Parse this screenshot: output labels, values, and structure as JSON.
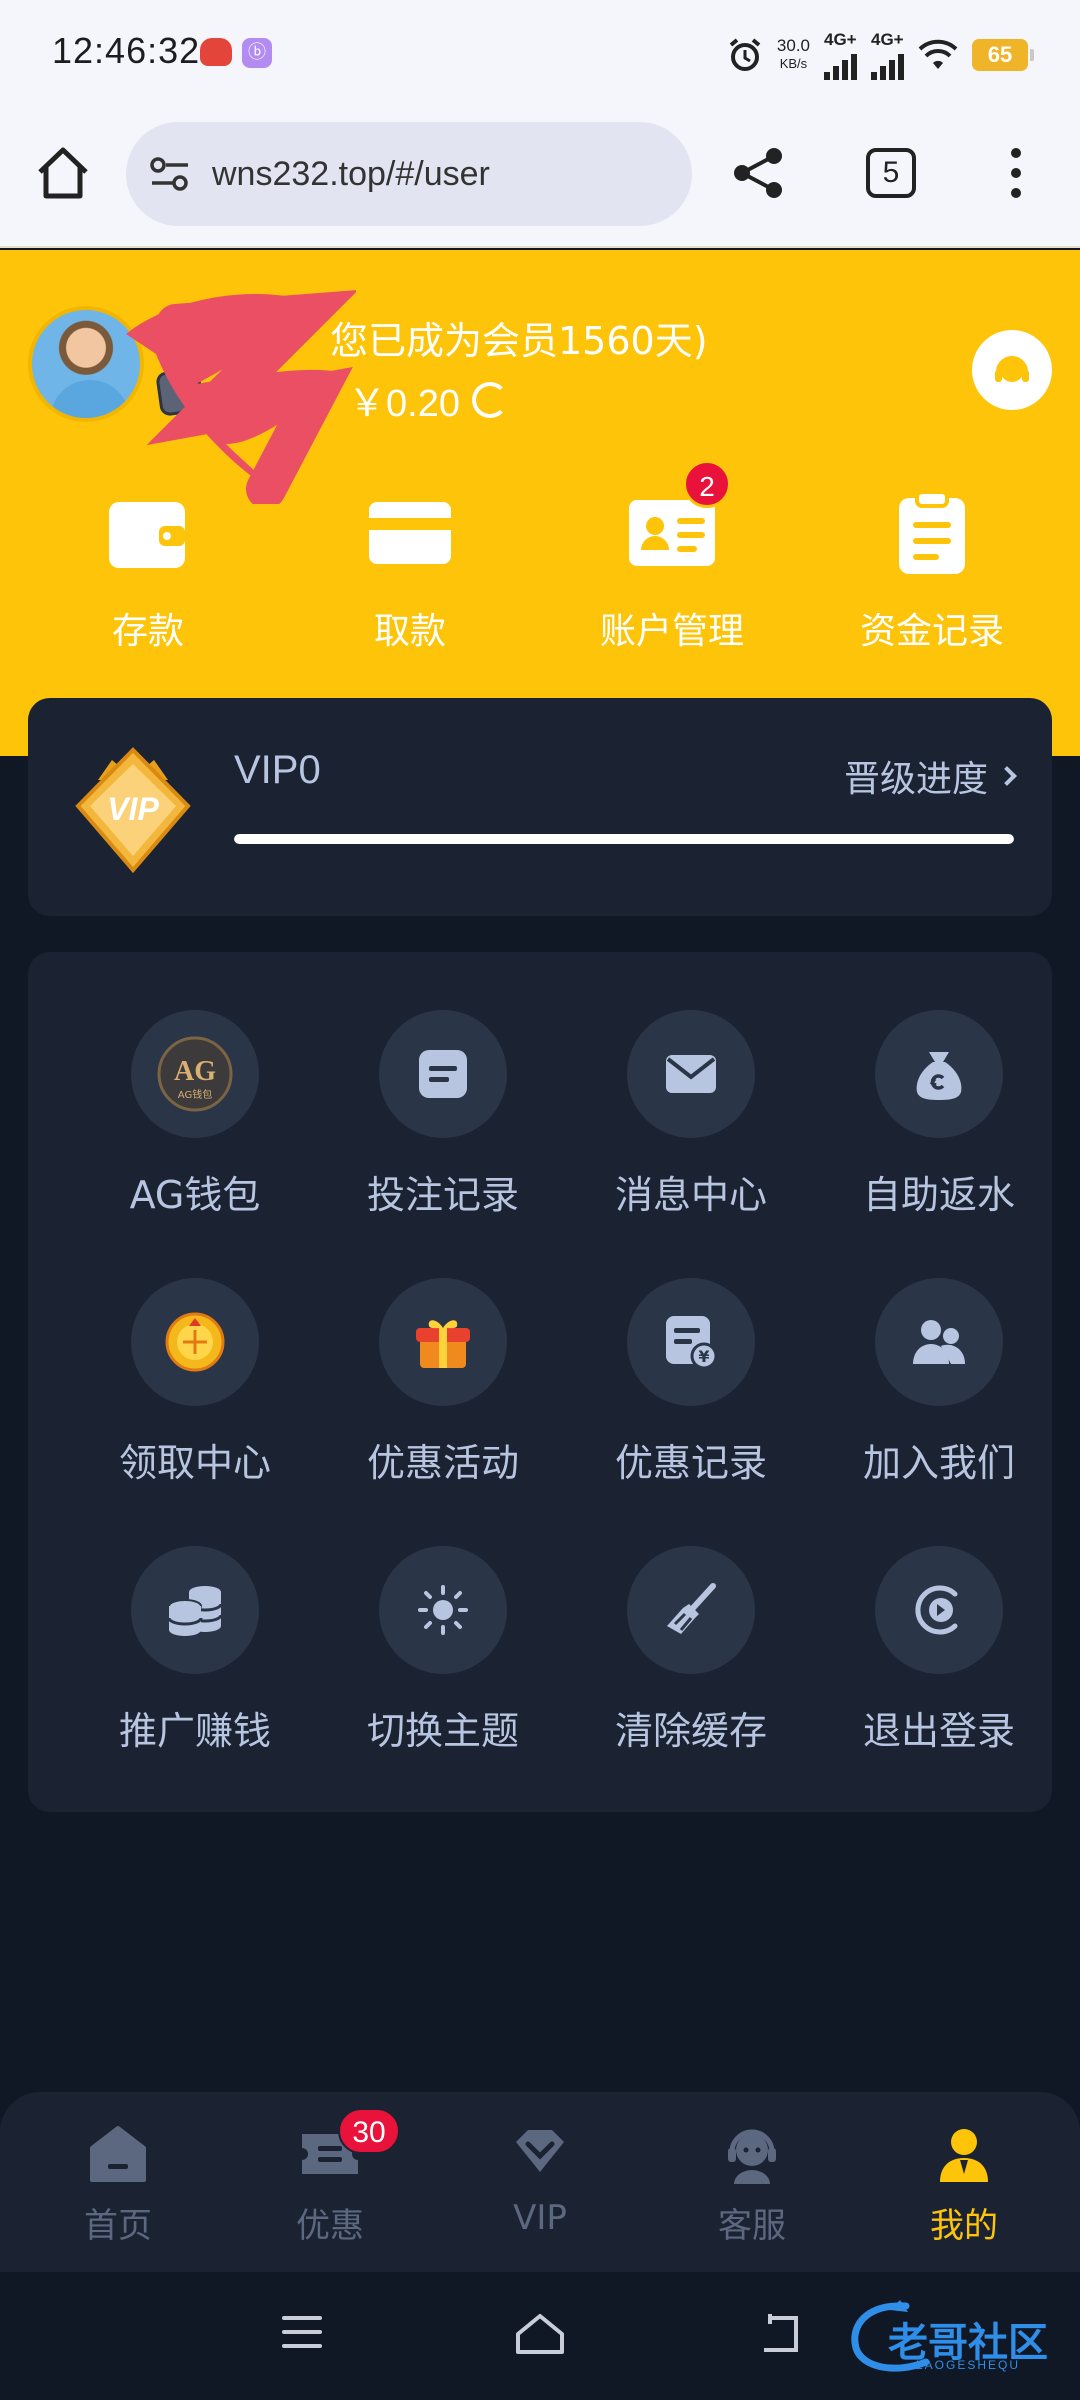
{
  "status_bar": {
    "time": "12:46:32",
    "net_speed_value": "30.0",
    "net_speed_unit": "KB/s",
    "signal1": "4G+",
    "signal2": "4G+",
    "battery": "65"
  },
  "browser": {
    "url": "wns232.top/#/user",
    "tab_count": "5"
  },
  "header": {
    "member_text": "您已成为会员1560天)",
    "balance": "￥0.20",
    "quick_actions": [
      {
        "label": "存款",
        "icon": "wallet-icon"
      },
      {
        "label": "取款",
        "icon": "card-icon"
      },
      {
        "label": "账户管理",
        "icon": "id-card-icon",
        "badge": "2"
      },
      {
        "label": "资金记录",
        "icon": "clipboard-icon"
      }
    ]
  },
  "vip": {
    "emblem_text": "VIP",
    "level": "VIP0",
    "progress_label": "晋级进度",
    "progress_fraction": 1.0
  },
  "menu": {
    "items": [
      {
        "label": "AG钱包",
        "icon": "ag-wallet-icon"
      },
      {
        "label": "投注记录",
        "icon": "bet-record-icon"
      },
      {
        "label": "消息中心",
        "icon": "envelope-icon"
      },
      {
        "label": "自助返水",
        "icon": "money-bag-icon"
      },
      {
        "label": "领取中心",
        "icon": "gold-coin-icon"
      },
      {
        "label": "优惠活动",
        "icon": "gift-icon"
      },
      {
        "label": "优惠记录",
        "icon": "yuan-document-icon"
      },
      {
        "label": "加入我们",
        "icon": "users-icon"
      },
      {
        "label": "推广赚钱",
        "icon": "coin-stack-icon"
      },
      {
        "label": "切换主题",
        "icon": "sun-icon"
      },
      {
        "label": "清除缓存",
        "icon": "broom-icon"
      },
      {
        "label": "退出登录",
        "icon": "logout-icon"
      }
    ],
    "ag_logo_text": "AG",
    "ag_logo_sub": "AG钱包"
  },
  "tabbar": {
    "tabs": [
      {
        "label": "首页",
        "icon": "home-icon"
      },
      {
        "label": "优惠",
        "icon": "coupon-icon",
        "badge": "30"
      },
      {
        "label": "VIP",
        "icon": "diamond-icon"
      },
      {
        "label": "客服",
        "icon": "support-agent-icon"
      },
      {
        "label": "我的",
        "icon": "profile-icon",
        "active": true
      }
    ]
  },
  "watermark": {
    "text": "老哥社区",
    "sub": "LAOGESHEQU"
  },
  "colors": {
    "brand_yellow": "#fdc40a",
    "page_bg": "#101826",
    "card_bg": "#1b2333",
    "badge_red": "#e8123a"
  }
}
